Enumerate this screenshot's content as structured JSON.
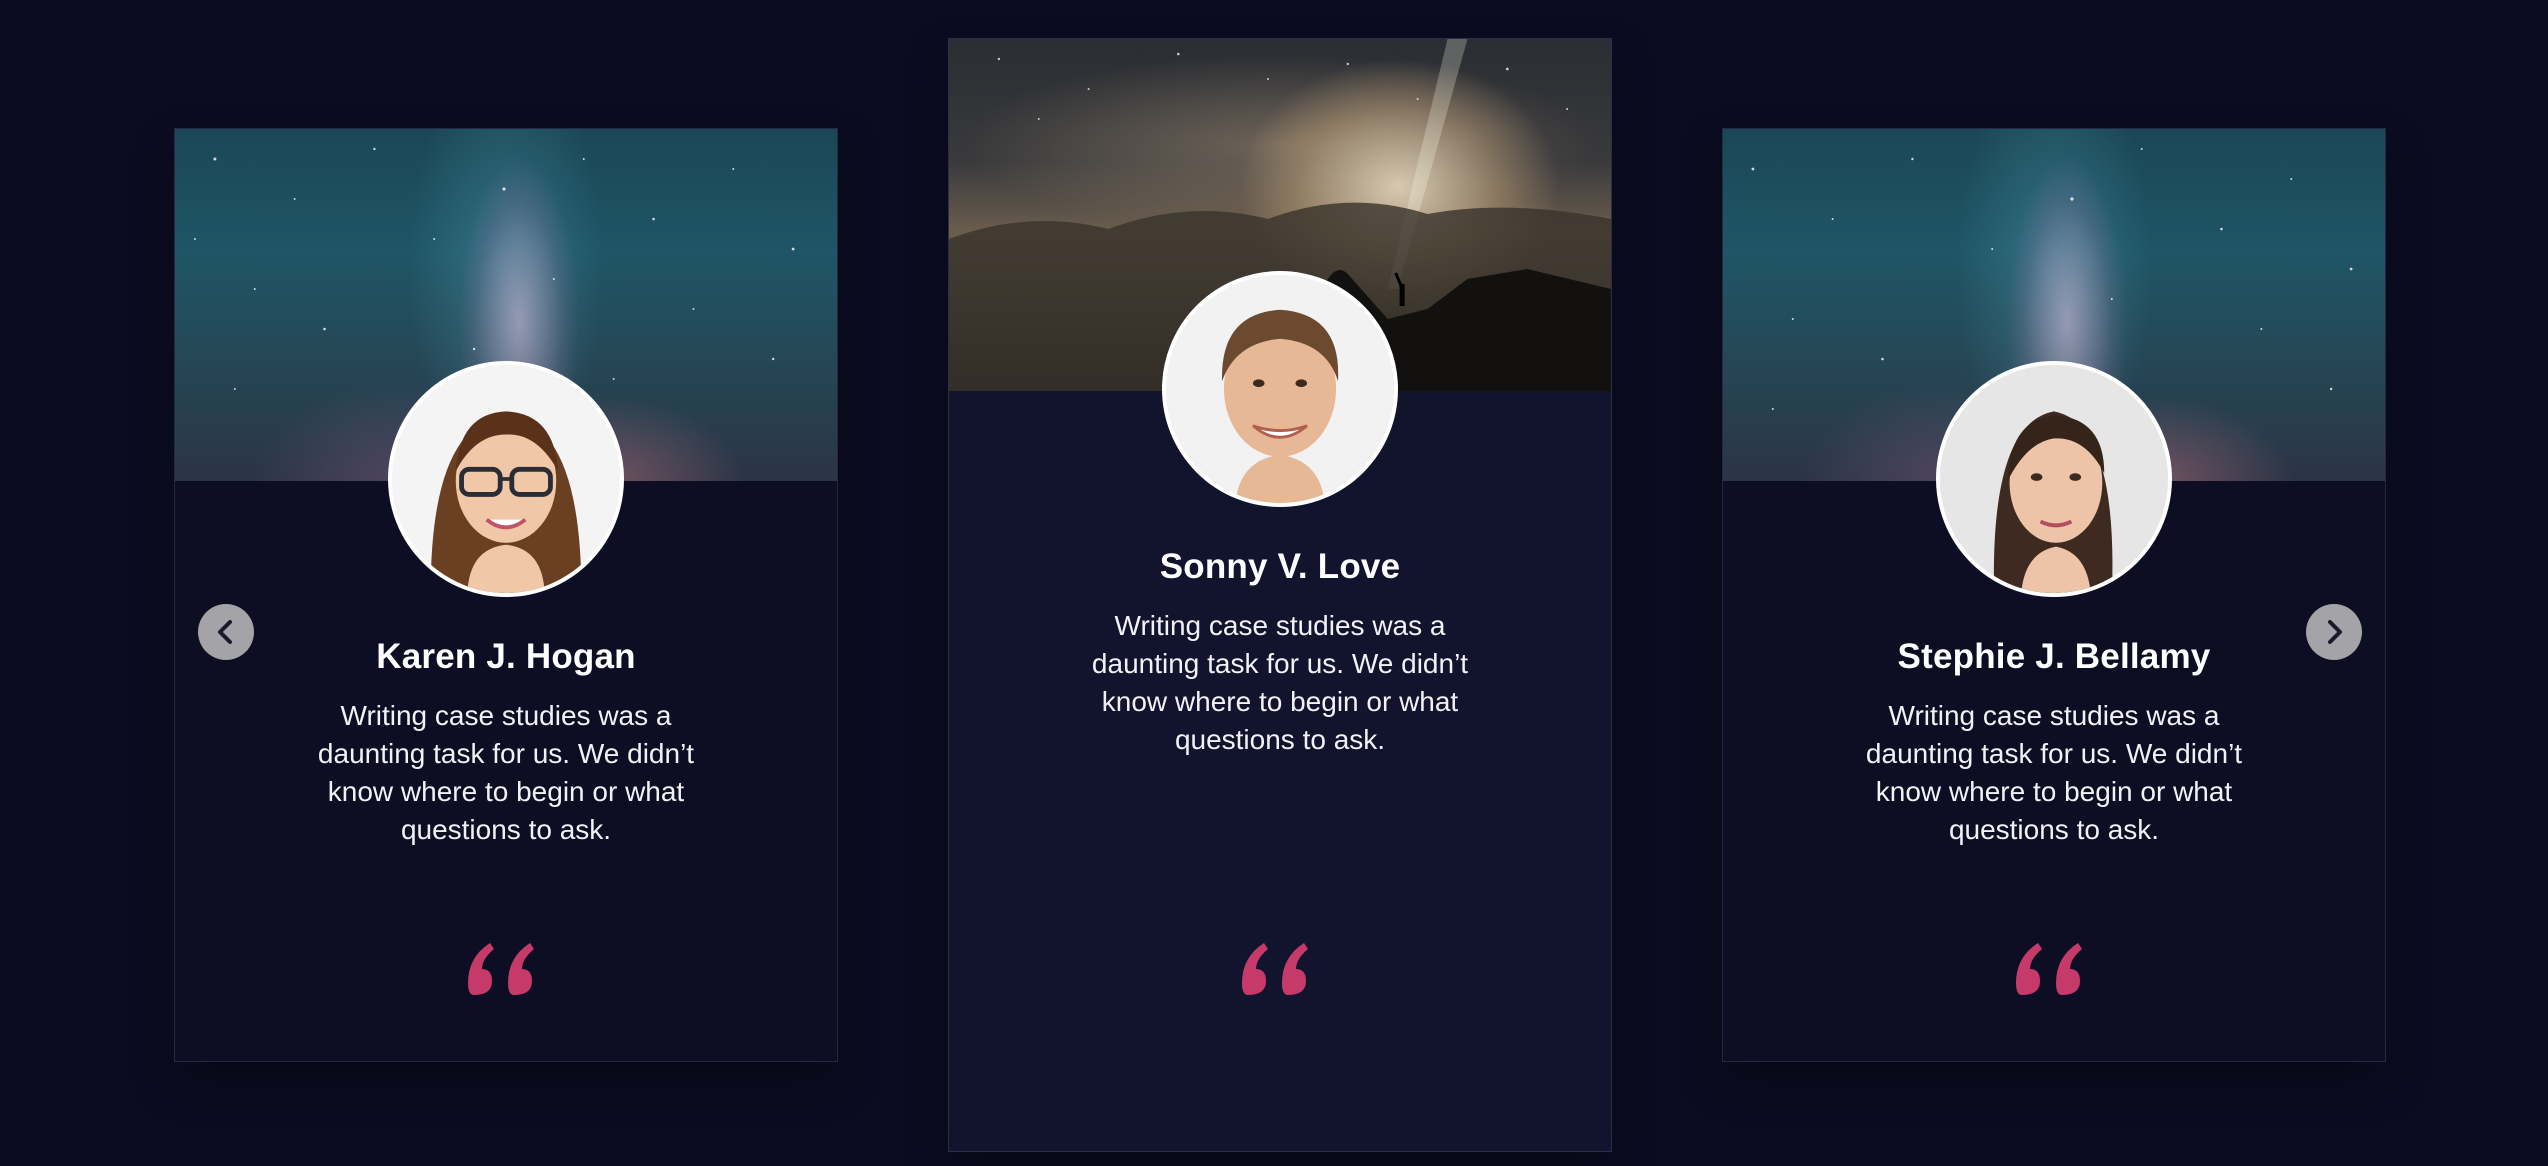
{
  "colors": {
    "page_background": "#0b0c21",
    "card_background": "#0d0e24",
    "card_active_background": "#12142d",
    "quote_accent": "#c63a6a",
    "nav_button": "#a3a3a8"
  },
  "carousel": {
    "prev_icon": "chevron-left-icon",
    "next_icon": "chevron-right-icon",
    "cards": [
      {
        "name": "Karen J. Hogan",
        "text": "Writing case studies was a daunting task for us. We didn’t know where to begin or what questions to ask.",
        "banner": "milky-way",
        "quote_icon": "quote-icon"
      },
      {
        "name": "Sonny V. Love",
        "text": "Writing case studies was a daunting task for us. We didn’t know where to begin or what questions to ask.",
        "banner": "mountain-night",
        "quote_icon": "quote-icon"
      },
      {
        "name": "Stephie J. Bellamy",
        "text": "Writing case studies was a daunting task for us. We didn’t know where to begin or what questions to ask.",
        "banner": "milky-way",
        "quote_icon": "quote-icon"
      }
    ]
  }
}
